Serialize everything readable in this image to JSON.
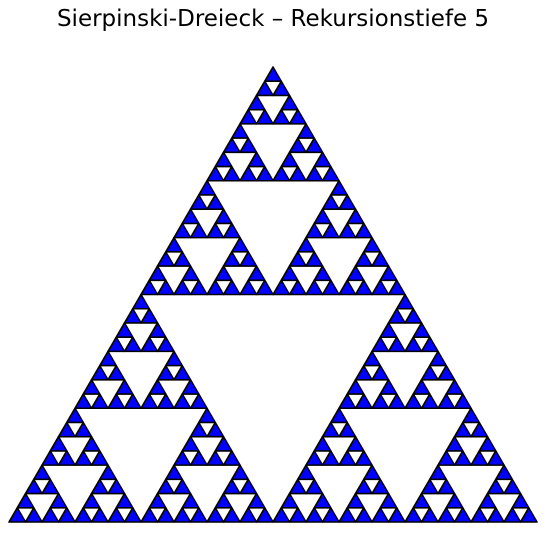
{
  "figure": {
    "title": "Sierpinski-Dreieck – Rekursionstiefe 5",
    "recursion_depth": 5,
    "fill_color": "#0000ff",
    "edge_color": "#000000",
    "background_color": "#ffffff"
  }
}
